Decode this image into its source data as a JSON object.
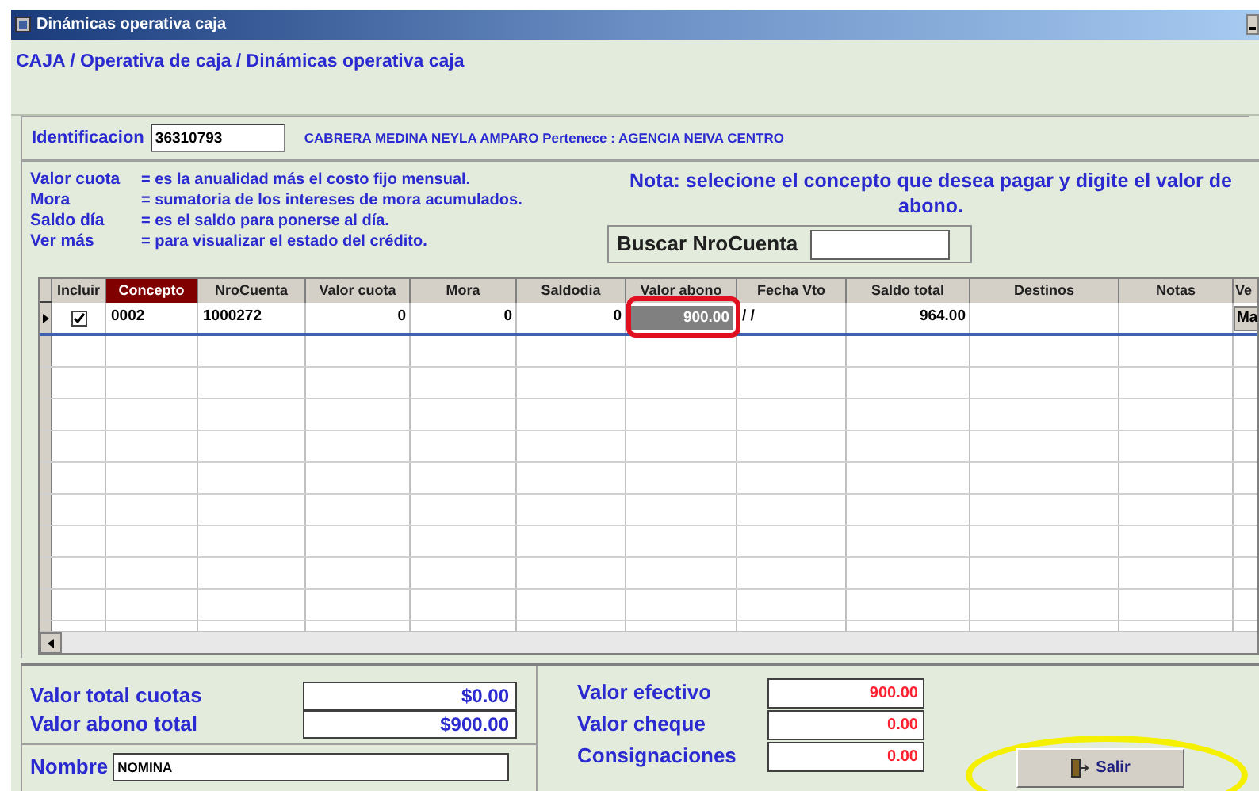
{
  "window": {
    "title": "Dinámicas operativa caja"
  },
  "breadcrumb": "CAJA / Operativa de caja / Dinámicas operativa caja",
  "identification": {
    "label": "Identificacion",
    "value": "36310793",
    "client_info": "CABRERA MEDINA NEYLA AMPARO Pertenece : AGENCIA NEIVA CENTRO"
  },
  "legend": [
    {
      "term": "Valor cuota",
      "definition": "=  es la anualidad más el costo fijo mensual."
    },
    {
      "term": "Mora",
      "definition": "=  sumatoria de los intereses de mora  acumulados."
    },
    {
      "term": "Saldo día",
      "definition": "=  es el saldo para ponerse al día."
    },
    {
      "term": "Ver más",
      "definition": "=  para visualizar el estado del crédito."
    }
  ],
  "note_lines": [
    "Nota:  selecione el concepto que desea pagar y digite el valor de",
    "abono."
  ],
  "search": {
    "label": "Buscar NroCuenta"
  },
  "grid": {
    "columns": [
      {
        "label": "Incluir",
        "kind": "check",
        "selected": false
      },
      {
        "label": "Concepto",
        "kind": "text",
        "selected": true
      },
      {
        "label": "NroCuenta",
        "kind": "text",
        "selected": false
      },
      {
        "label": "Valor cuota",
        "kind": "number",
        "selected": false
      },
      {
        "label": "Mora",
        "kind": "number",
        "selected": false
      },
      {
        "label": "Saldodia",
        "kind": "number",
        "selected": false
      },
      {
        "label": "Valor abono",
        "kind": "number",
        "selected": false
      },
      {
        "label": "Fecha Vto",
        "kind": "text",
        "selected": false
      },
      {
        "label": "Saldo total",
        "kind": "number",
        "selected": false
      },
      {
        "label": "Destinos",
        "kind": "text",
        "selected": false
      },
      {
        "label": "Notas",
        "kind": "text",
        "selected": false
      },
      {
        "label": "Ve",
        "kind": "button",
        "selected": false
      }
    ],
    "rows": [
      {
        "current": true,
        "cells": [
          {
            "checked": true
          },
          {
            "text": "0002",
            "selected": false
          },
          {
            "text": "1000272",
            "selected": false
          },
          {
            "text": "0",
            "selected": false
          },
          {
            "text": "0",
            "selected": false
          },
          {
            "text": "0",
            "selected": false
          },
          {
            "text": "900.00",
            "selected": true
          },
          {
            "text": "/ /",
            "selected": false
          },
          {
            "text": "964.00",
            "selected": false
          },
          null,
          null,
          {
            "text": "Ma",
            "selected": false
          }
        ]
      }
    ]
  },
  "totals": [
    {
      "label": "Valor total  cuotas",
      "value": "$0.00"
    },
    {
      "label": "Valor abono total",
      "value": "$900.00"
    }
  ],
  "name_field": {
    "label": "Nombre",
    "value": "NOMINA"
  },
  "payments": [
    {
      "label": "Valor efectivo",
      "value": "900.00"
    },
    {
      "label": "Valor cheque",
      "value": "0.00"
    },
    {
      "label": "Consignaciones",
      "value": "0.00"
    }
  ],
  "exit_button": {
    "label": "Salir"
  }
}
